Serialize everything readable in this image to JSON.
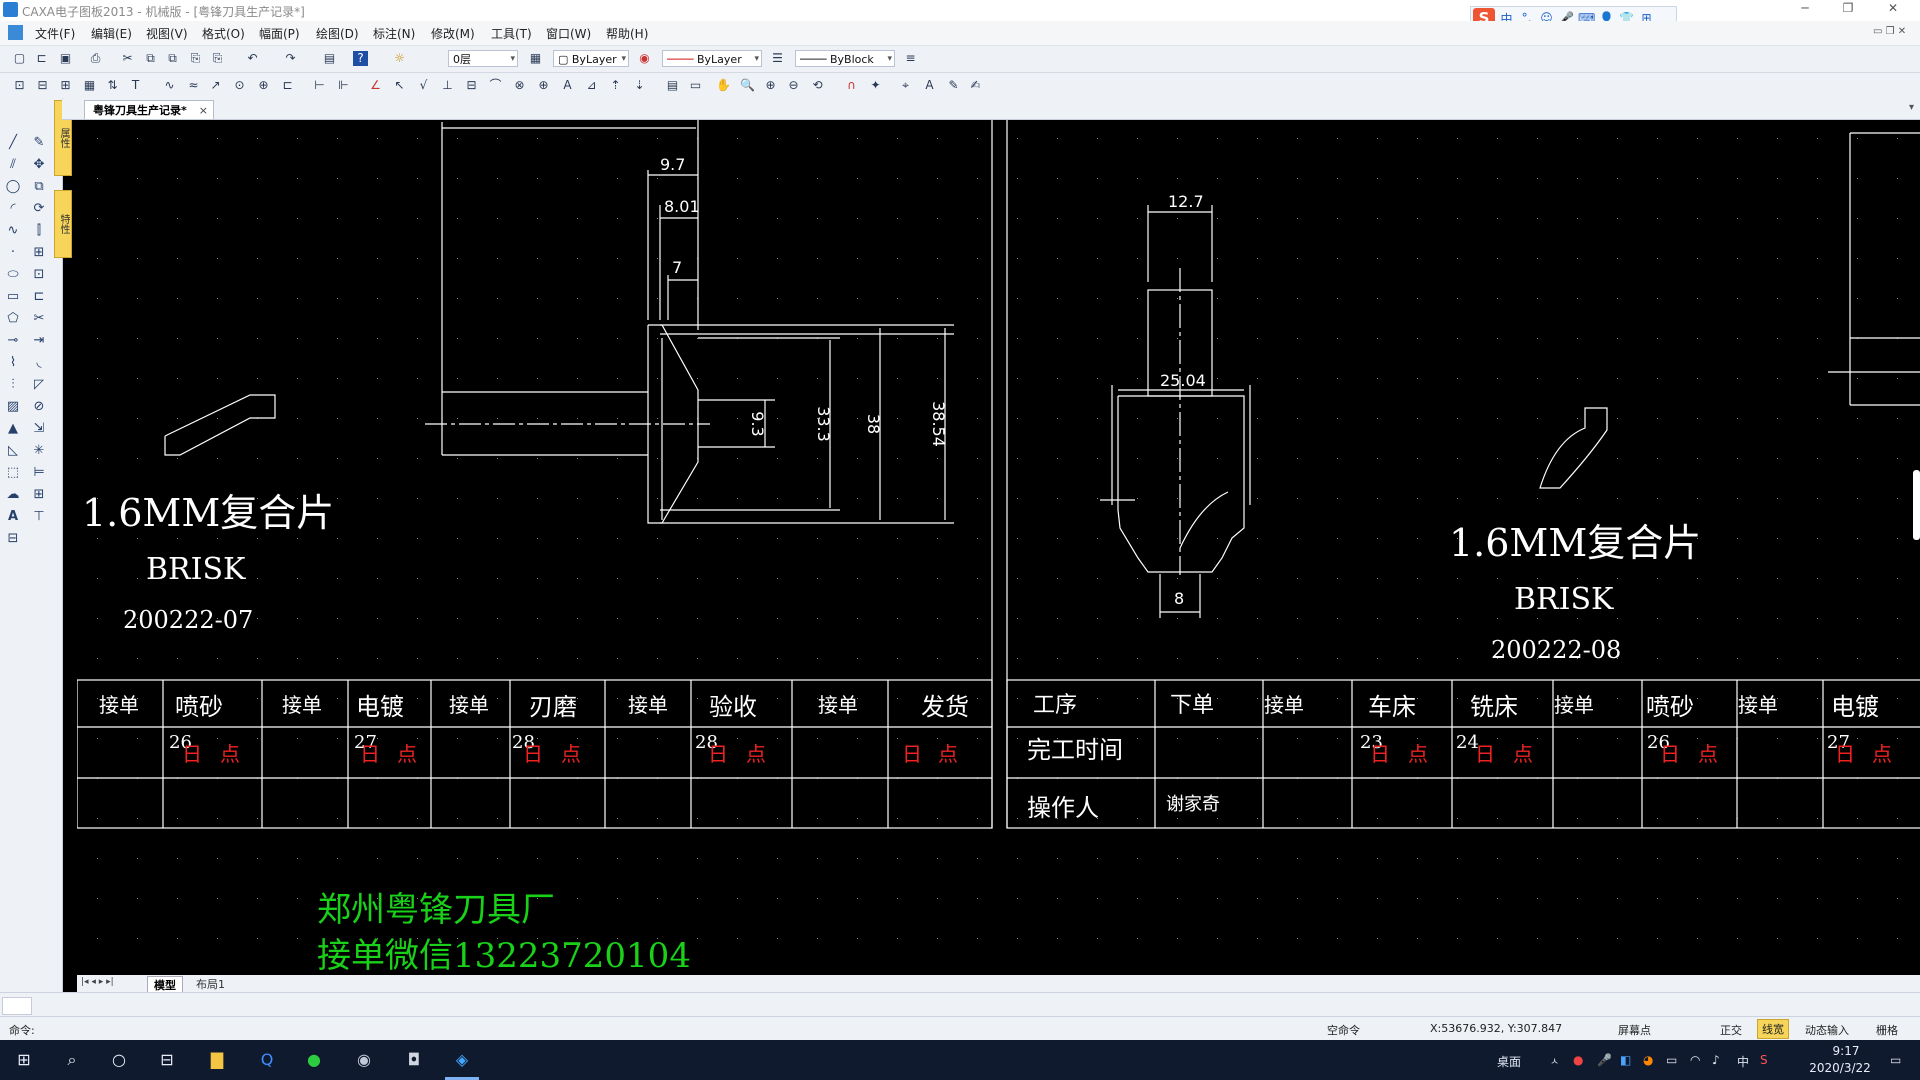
{
  "window": {
    "title": "CAXA电子图板2013 - 机械版 - [粤锋刀具生产记录*]",
    "min": "─",
    "max": "❐",
    "close": "✕"
  },
  "ime": {
    "logo": "S",
    "items": [
      "中",
      "°,",
      "☺",
      "🎤",
      "⌨",
      "👤",
      "👕",
      "⊞"
    ]
  },
  "menu": [
    "文件(F)",
    "编辑(E)",
    "视图(V)",
    "格式(O)",
    "幅面(P)",
    "绘图(D)",
    "标注(N)",
    "修改(M)",
    "工具(T)",
    "窗口(W)",
    "帮助(H)"
  ],
  "toolbar": {
    "layer": "0层",
    "color": "ByLayer",
    "linetype": "ByLayer",
    "lineweight": "ByBlock"
  },
  "lefttabs": [
    "属性",
    "特性"
  ],
  "doc_tab": {
    "label": "粤锋刀具生产记录*",
    "close": "×"
  },
  "sheet_tabs": [
    "模型",
    "布局1"
  ],
  "command": {
    "label": "命令:"
  },
  "status": {
    "empty_cmd": "空命令",
    "coords": "X:53676.932, Y:307.847",
    "snap": "屏幕点",
    "ortho": "正交",
    "linewidth": "线宽",
    "dyn": "动态输入",
    "grid": "栅格"
  },
  "taskbar": {
    "tray_text": "桌面",
    "ime": "中",
    "time": "9:17",
    "date": "2020/3/22"
  },
  "drawing": {
    "left": {
      "title": "1.6MM复合片",
      "brand": "BRISK",
      "code": "200222-07",
      "dims": [
        "9.7",
        "8.01",
        "7",
        "9.3",
        "33.3",
        "38",
        "38.54"
      ],
      "header": [
        "接单",
        "喷砂",
        "接单",
        "电镀",
        "接单",
        "刃磨",
        "接单",
        "验收",
        "接单",
        "发货"
      ],
      "row1": [
        {
          "num": "26",
          "ri": "日",
          "dian": "点"
        },
        {
          "num": "27",
          "ri": "日",
          "dian": "点"
        },
        {
          "num": "28",
          "ri": "日",
          "dian": "点"
        },
        {
          "num": "28",
          "ri": "日",
          "dian": "点"
        },
        {
          "num": "",
          "ri": "日",
          "dian": "点"
        }
      ]
    },
    "right": {
      "title": "1.6MM复合片",
      "brand": "BRISK",
      "code": "200222-08",
      "dims": [
        "12.7",
        "25.04",
        "8"
      ],
      "header": [
        "工序",
        "下单",
        "接单",
        "车床",
        "铣床",
        "接单",
        "喷砂",
        "接单",
        "电镀"
      ],
      "row1_label": "完工时间",
      "row2_label": "操作人",
      "operator": "谢家奇",
      "row1": [
        {
          "num": "23",
          "ri": "日",
          "dian": "点"
        },
        {
          "num": "24",
          "ri": "日",
          "dian": "点"
        },
        {
          "num": "26",
          "ri": "日",
          "dian": "点"
        },
        {
          "num": "27",
          "ri": "日",
          "dian": "点"
        }
      ]
    },
    "footer": [
      "郑州粤锋刀具厂",
      "接单微信13223720104"
    ]
  }
}
